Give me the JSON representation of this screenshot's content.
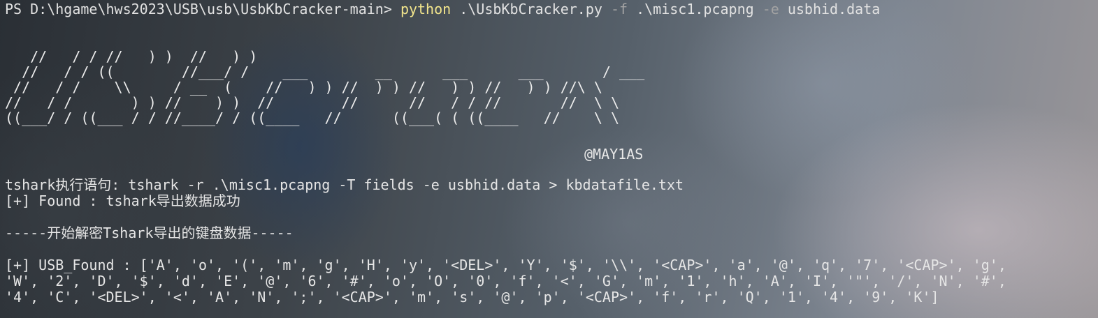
{
  "prompt": {
    "path": "PS D:\\hgame\\hws2023\\USB\\usb\\UsbKbCracker-main> ",
    "executable": "python",
    "script": " .\\UsbKbCracker.py ",
    "flag_f": "-f",
    "file_arg": " .\\misc1.pcapng ",
    "flag_e": "-e",
    "field_arg": " usbhid.data"
  },
  "banner": {
    "ascii_art": "   //   / / //   ) )  //   ) )\n  //   / / ((        //___/ /    ___        __      ___      ___       / ___\n //   / /    \\\\     / __  (    //   ) ) //  ) ) //   ) ) //   ) ) //\\ \\\n//   / /       ) ) //    ) )  //        //      //   / / //       //  \\ \\\n((___/ / ((___ / / //____/ / ((____   //      ((___( ( ((____   //    \\ \\",
    "author": "@MAY1AS"
  },
  "output": {
    "tshark_cmd": "tshark执行语句: tshark -r .\\misc1.pcapng -T fields -e usbhid.data > kbdatafile.txt",
    "found_line": "[+] Found : tshark导出数据成功",
    "section_header": "-----开始解密Tshark导出的键盘数据-----",
    "usb_found_1": "[+] USB_Found : ['A', 'o', '(', 'm', 'g', 'H', 'y', '<DEL>', 'Y', '$', '\\\\', '<CAP>', 'a', '@', 'q', '7', '<CAP>', 'g',",
    "usb_found_2": "'W', '2', 'D', '$', 'd', 'E', '@', '6', '#', 'o', 'O', '0', 'f', '<', 'G', 'm', '1', 'h', 'A', 'I', '\"', '/', 'N', '#',",
    "usb_found_3": "'4', 'C', '<DEL>', '<', 'A', 'N', ';', '<CAP>', 'm', 's', '@', 'p', '<CAP>', 'f', 'r', 'Q', '1', '4', '9', 'K']"
  },
  "colors": {
    "executable": "#f2e58c",
    "flag": "#a3a3a3",
    "text": "#e2e2e2"
  }
}
